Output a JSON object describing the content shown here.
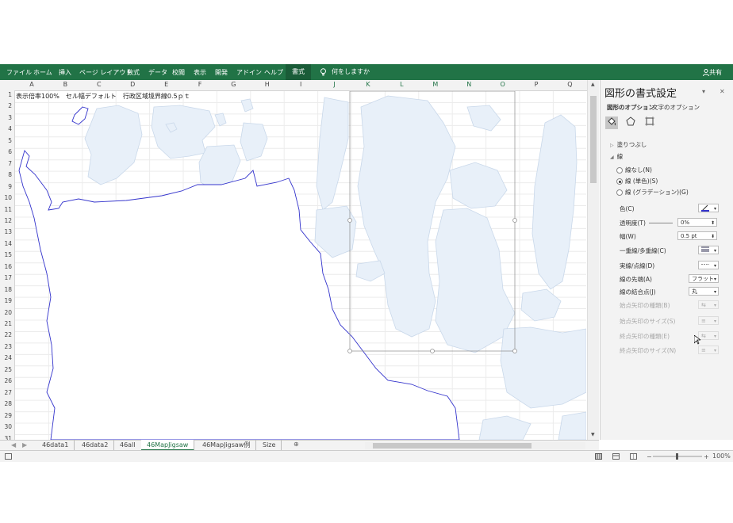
{
  "ribbon": {
    "tabs": [
      "ファイル",
      "ホーム",
      "挿入",
      "ページ レイアウト",
      "数式",
      "データ",
      "校閲",
      "表示",
      "開発",
      "アドイン",
      "ヘルプ",
      "書式"
    ],
    "active_tab": "書式",
    "tell_me": "何をしますか",
    "share": "共有",
    "bg_color": "#217346"
  },
  "sheet": {
    "columns": [
      "A",
      "B",
      "C",
      "D",
      "E",
      "F",
      "G",
      "H",
      "I",
      "J",
      "K",
      "L",
      "M",
      "N",
      "O",
      "P",
      "Q"
    ],
    "selected_columns": [
      "J",
      "K",
      "L",
      "M",
      "N",
      "O"
    ],
    "rows": [
      "1",
      "2",
      "3",
      "4",
      "5",
      "6",
      "7",
      "8",
      "9",
      "10",
      "11",
      "12",
      "13",
      "14",
      "15",
      "16",
      "17",
      "18",
      "19",
      "20",
      "21",
      "22",
      "23",
      "24",
      "25",
      "26",
      "27",
      "28",
      "29",
      "30",
      "31"
    ],
    "cell_a1": "表示倍率100%　セル幅デフォルト　行政区域境界線0.5ｐｔ",
    "map_line_color": "#3333cc",
    "map_fill_color": "#e8f0f9"
  },
  "sheet_tabs": {
    "tabs": [
      "46data1",
      "46data2",
      "46all",
      "46MapJigsaw",
      "46MapJigsaw例",
      "Size"
    ],
    "active": "46MapJigsaw",
    "add": "⊕"
  },
  "status": {
    "zoom": "100%"
  },
  "format_panel": {
    "title": "図形の書式設定",
    "subtabs": [
      "図形のオプション",
      "文字のオプション"
    ],
    "fill_section": "塗りつぶし",
    "line_section": "線",
    "radios": [
      "線なし(N)",
      "線 (単色)(S)",
      "線 (グラデーション)(G)"
    ],
    "selected_radio": 1,
    "props": [
      {
        "label": "色(C)",
        "value": "",
        "disabled": false
      },
      {
        "label": "透明度(T)",
        "value": "0%",
        "disabled": false
      },
      {
        "label": "幅(W)",
        "value": "0.5 pt",
        "disabled": false
      },
      {
        "label": "一重線/多重線(C)",
        "value": "",
        "disabled": false
      },
      {
        "label": "実線/点線(D)",
        "value": "",
        "disabled": false
      },
      {
        "label": "線の先端(A)",
        "value": "フラット",
        "disabled": false
      },
      {
        "label": "線の結合点(J)",
        "value": "丸",
        "disabled": false
      },
      {
        "label": "始点矢印の種類(B)",
        "value": "",
        "disabled": true
      },
      {
        "label": "始点矢印のサイズ(S)",
        "value": "",
        "disabled": true
      },
      {
        "label": "終点矢印の種類(E)",
        "value": "",
        "disabled": true
      },
      {
        "label": "終点矢印のサイズ(N)",
        "value": "",
        "disabled": true
      }
    ]
  }
}
